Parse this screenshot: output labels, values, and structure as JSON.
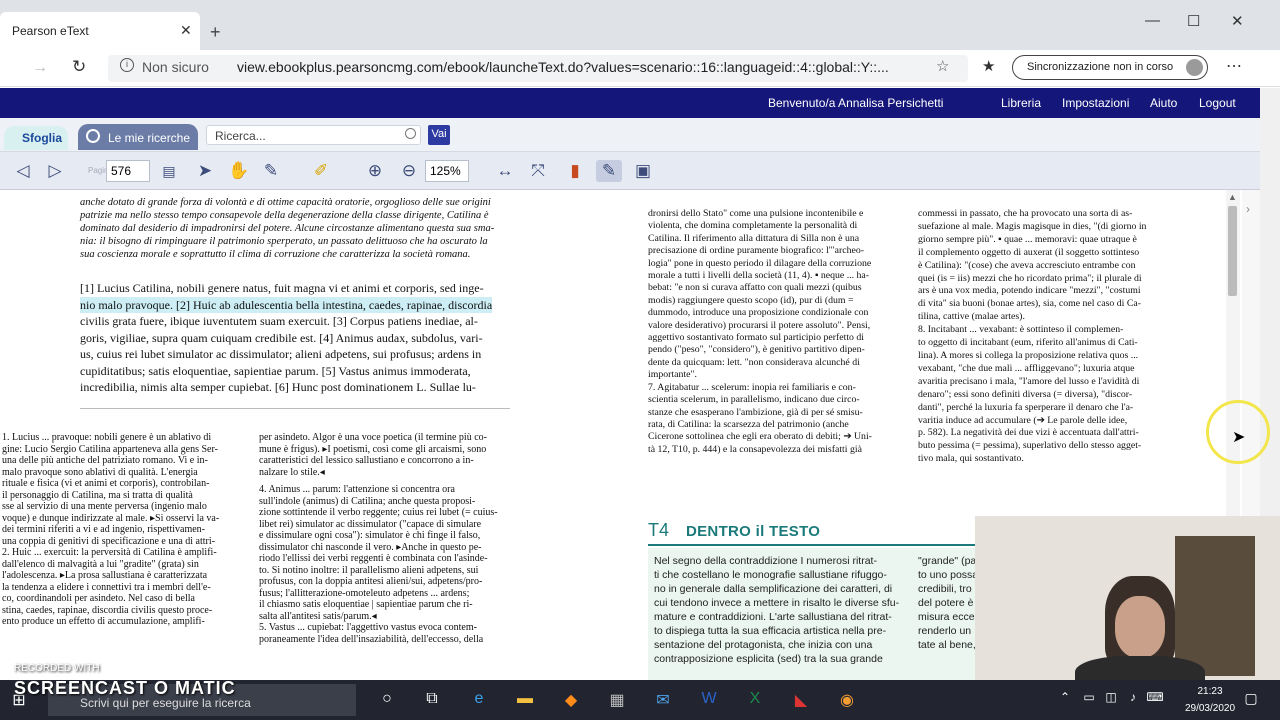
{
  "browser": {
    "tab_title": "Pearson eText",
    "tab_close": "✕",
    "new_tab": "+",
    "insecure_label": "Non sicuro",
    "url": "view.ebookplus.pearsoncmg.com/ebook/launcheText.do?values=scenario::16::languageid::4::global::Y::...",
    "sync_label": "Sincronizzazione non in corso",
    "menu": "⋯",
    "min": "—",
    "max": "☐",
    "close": "✕"
  },
  "header": {
    "welcome": "Benvenuto/a Annalisa Persichetti",
    "links": [
      "Libreria",
      "Impostazioni",
      "Aiuto",
      "Logout"
    ]
  },
  "toolbar1": {
    "sfoglia": "Sfoglia",
    "mie_ricerche": "Le mie ricerche",
    "search_placeholder": "Ricerca...",
    "vai": "Vai"
  },
  "toolbar2": {
    "page_label": "Pagina",
    "page": "576",
    "zoom": "125%"
  },
  "document": {
    "intro": [
      "anche dotato di grande forza di volontà e di ottime capacità oratorie, orgoglioso delle sue origini",
      "patrizie ma nello stesso tempo consapevole della degenerazione della classe dirigente, Catilina è",
      "dominato dal desiderio di impadronirsi del potere. Alcune circostanze alimentano questa sua sma-",
      "nia: il bisogno di rimpinguare il patrimonio sperperato, un passato delittuoso che ha oscurato la",
      "sua coscienza morale e soprattutto il clima di corruzione che caratterizza la società romana."
    ],
    "latin": [
      "[1] Lucius Catilina, nobili genere natus, fuit magna vi et animi et corporis, sed inge-",
      "nio malo pravoque. [2] Huic ab adulescentia bella intestina, caedes, rapinae, discordia",
      "civilis grata fuere, ibique iuventutem suam exercuit. [3] Corpus patiens inediae, al-",
      "goris, vigiliae, supra quam cuiquam credibile est. [4] Animus audax, subdolus, vari-",
      "us, cuius rei lubet simulator ac dissimulator; alieni adpetens, sui profusus; ardens in",
      "cupiditatibus; satis eloquentiae, sapientiae parum. [5] Vastus animus immoderata,",
      "incredibilia, nimis alta semper cupiebat. [6] Hunc post dominationem L. Sullae lu-"
    ],
    "notes_left": [
      "1. Lucius ... pravoque: nobili genere è un ablativo di",
      "gine: Lucio Sergio Catilina apparteneva alla gens Ser-",
      "una delle più antiche del patriziato romano. Vi e in-",
      "malo pravoque sono ablativi di qualità. L'energia",
      "rituale e fisica (vi et animi et corporis), controbilan-",
      "il personaggio di Catilina, ma si tratta di qualità",
      "sse al servizio di una mente perversa (ingenio malo",
      "voque) e dunque indirizzate al male. ▸Si osservi la va-",
      "dei termini riferiti a vi e ad ingenio, rispettivamen-",
      "una coppia di genitivi di specificazione e una di attri-",
      "",
      "2. Huic ... exercuit: la perversità di Catilina è amplifi-",
      "dall'elenco di malvagità a lui \"gradite\" (grata) sin",
      "l'adolescenza. ▸La prosa sallustiana è caratterizzata",
      "la tendenza a elidere i connettivi tra i membri dell'e-",
      "co, coordinandoli per asindeto. Nel caso di bella",
      "stina, caedes, rapinae, discordia civilis questo proce-",
      "ento produce un effetto di accumulazione, amplifi-"
    ],
    "notes_mid": [
      "per asindeto. Algor è una voce poetica (il termine più co-",
      "mune è frigus). ▸I poetismi, così come gli arcaismi, sono",
      "caratteristici del lessico sallustiano e concorrono a in-",
      "nalzare lo stile.◂",
      "4. Animus ... parum: l'attenzione si concentra ora",
      "sull'indole (animus) di Catilina; anche questa proposi-",
      "zione sottintende il verbo reggente; cuius rei lubet (= cuius-",
      "libet rei) simulator ac dissimulator (\"capace di simulare",
      "e dissimulare ogni cosa\"): simulator è chi finge il falso,",
      "dissimulator chi nasconde il vero. ▸Anche in questo pe-",
      "riodo l'ellissi dei verbi reggenti è combinata con l'asinde-",
      "to. Si notino inoltre: il parallelismo alieni adpetens, sui",
      "profusus, con la doppia antitesi alieni/sui, adpetens/pro-",
      "fusus; l'allitterazione-omoteleuto adpetens ... ardens;",
      "il chiasmo satis eloquentiae | sapientiae parum che ri-",
      "salta all'antitesi satis/parum.◂",
      "5. Vastus ... cupiebat: l'aggettivo vastus evoca contem-",
      "poraneamente l'idea dell'insaziabilità, dell'eccesso, della"
    ],
    "notes_right1": [
      "dronirsi dello Stato\" come una pulsione incontenibile e",
      "violenta, che domina completamente la personalità di",
      "Catilina. Il riferimento alla dittatura di Silla non è una",
      "precisazione di ordine puramente biografico: l'\"archeo-",
      "logia\" pone in questo periodo il dilagare della corruzione",
      "morale a tutti i livelli della società (11, 4). ▪ neque ... ha-",
      "bebat: \"e non si curava affatto con quali mezzi (quibus",
      "modis) raggiungere questo scopo (id), pur di (dum =",
      "dummodo, introduce una proposizione condizionale con",
      "valore desiderativo) procurarsi il potere assoluto\". Pensi,",
      "aggettivo sostantivato formato sul participio perfetto di",
      "pendo (\"peso\", \"considero\"), è genitivo partitivo dipen-",
      "dente da quicquam: lett. \"non considerava alcunché di",
      "importante\".",
      "7. Agitabatur ... scelerum: inopia rei familiaris e con-",
      "scientia scelerum, in parallelismo, indicano due circo-",
      "stanze che esasperano l'ambizione, già di per sé smisu-",
      "rata, di Catilina: la scarsezza del patrimonio (anche",
      "Cicerone sottolinea che egli era oberato di debiti; ➔ Uni-",
      "tà 12, T10, p. 444) e la consapevolezza dei misfatti già"
    ],
    "notes_right2": [
      "commessi in passato, che ha provocato una sorta di as-",
      "suefazione al male. Magis magisque in dies, \"(di giorno in",
      "giorno sempre più\". ▪ quae ... memoravi: quae utraque è",
      "il complemento oggetto di auxerat (il soggetto sottinteso",
      "è Catilina): \"(cose) che aveva accresciuto entrambe con",
      "quei (is = iis) mezzi che ho ricordato prima\"; il plurale di",
      "ars è una vox media, potendo indicare \"mezzi\", \"costumi",
      "di vita\" sia buoni (bonae artes), sia, come nel caso di Ca-",
      "tilina, cattive (malae artes).",
      "8. Incitabant ... vexabant: è sottinteso il complemen-",
      "to oggetto di incitabant (eum, riferito all'animus di Cati-",
      "lina). A mores si collega la proposizione relativa quos ...",
      "vexabant, \"che due mali ... affliggevano\"; luxuria atque",
      "avaritia precisano i mala, \"l'amore del lusso e l'avidità di",
      "denaro\"; essi sono definiti diversa (= diversa), \"discor-",
      "danti\", perché la luxuria fa sperperare il denaro che l'a-",
      "varitia induce ad accumulare (➔ Le parole delle idee,",
      "p. 582). La negatività dei due vizi è accentuata dall'attri-",
      "buto pessima (= pessima), superlativo dello stesso agget-",
      "tivo mala, qui sostantivato."
    ],
    "t4_num": "T4",
    "t4_title": "DENTRO il TESTO",
    "t4_body": [
      "Nel segno della contraddizione I numerosi ritrat-",
      "ti che costellano le monografie sallustiane rifuggo-",
      "no in generale dalla semplificazione dei caratteri, di",
      "cui tendono invece a mettere in risalto le diverse sfu-",
      "mature e contraddizioni. L'arte sallustiana del ritrat-",
      "to dispiega tutta la sua efficacia artistica nella pre-",
      "sentazione del protagonista, che inizia con una",
      "contrapposizione esplicita (sed) tra la sua grande"
    ],
    "t4_body_right": [
      "\"grande\" (pa",
      "to uno possa",
      "credibili, tro",
      "del potere è",
      "misura ecce",
      "renderlo un",
      "tate al bene,"
    ]
  },
  "taskbar": {
    "search": "Scrivi qui per eseguire la ricerca",
    "time": "21:23",
    "date": "29/03/2020",
    "watermark": "SCREENCAST O MATIC",
    "recorded": "RECORDED WITH"
  }
}
